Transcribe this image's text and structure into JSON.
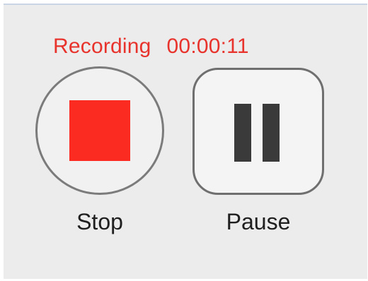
{
  "status": {
    "label": "Recording",
    "elapsed_time": "00:00:11",
    "color": "#e8332c"
  },
  "controls": {
    "stop": {
      "label": "Stop",
      "icon": "stop-square-icon",
      "icon_color": "#fb2b22"
    },
    "pause": {
      "label": "Pause",
      "icon": "pause-bars-icon",
      "icon_color": "#3a3a3a"
    }
  }
}
